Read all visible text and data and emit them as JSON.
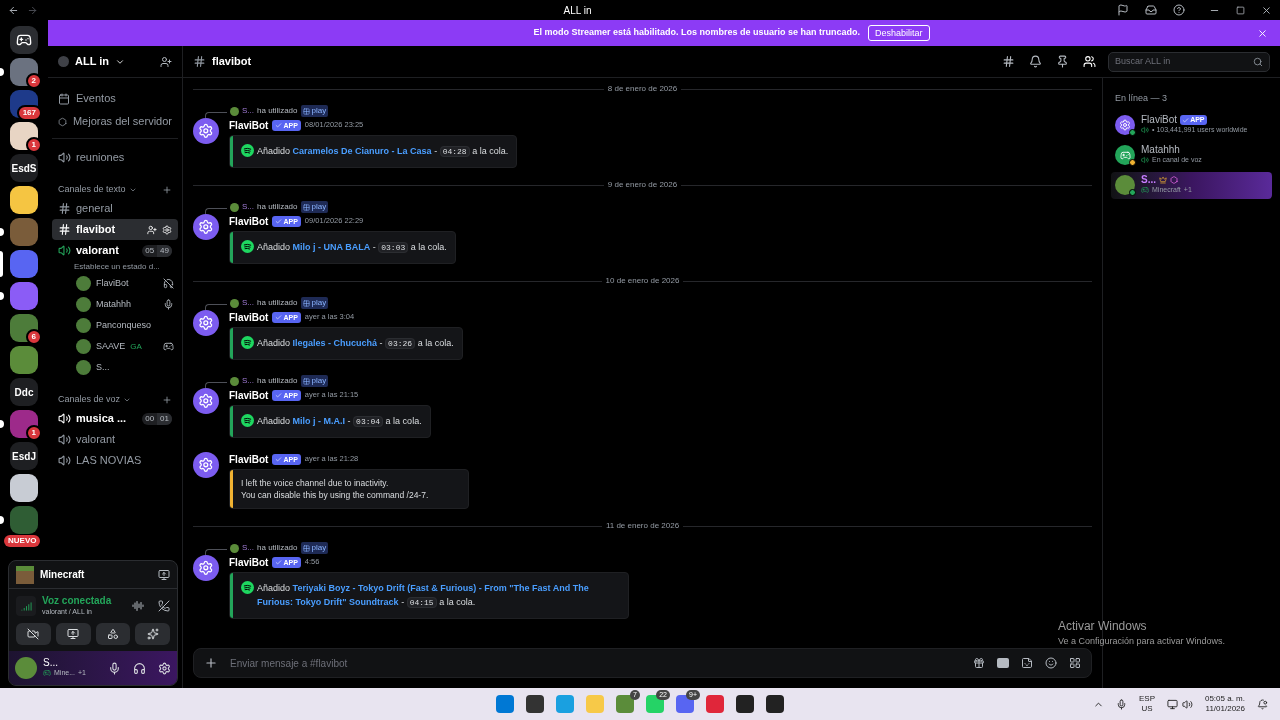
{
  "titlebar": {
    "title": "ALL in"
  },
  "servers": [
    {
      "kind": "home",
      "selected": false,
      "unread": false
    },
    {
      "kind": "photo",
      "badge": "2",
      "selected": false,
      "unread": true
    },
    {
      "kind": "photo",
      "badge": "167",
      "selected": false,
      "unread": false
    },
    {
      "kind": "photo",
      "badge": "1",
      "selected": false,
      "unread": false
    },
    {
      "kind": "text",
      "label": "EsdS",
      "selected": false,
      "unread": false
    },
    {
      "kind": "photo",
      "selected": false,
      "unread": false
    },
    {
      "kind": "photo",
      "selected": false,
      "unread": true
    },
    {
      "kind": "photo",
      "selected": true
    },
    {
      "kind": "photo",
      "selected": false,
      "unread": true
    },
    {
      "kind": "photo",
      "badge": "6",
      "selected": false,
      "unread": false
    },
    {
      "kind": "photo",
      "selected": false,
      "unread": false
    },
    {
      "kind": "text",
      "label": "Ddc",
      "selected": false,
      "unread": false
    },
    {
      "kind": "photo",
      "badge": "1",
      "selected": false,
      "unread": true
    },
    {
      "kind": "text",
      "label": "EsdJ",
      "selected": false,
      "unread": false
    },
    {
      "kind": "photo",
      "selected": false,
      "unread": false
    },
    {
      "kind": "photo",
      "badge": "NUEVO",
      "selected": false,
      "unread": true
    }
  ],
  "banner": {
    "text": "El modo Streamer está habilitado. Los nombres de usuario se han truncado.",
    "button": "Deshabilitar"
  },
  "channel_sidebar": {
    "server_name": "ALL in",
    "links": [
      {
        "kind": "events",
        "label": "Eventos"
      },
      {
        "kind": "boosts",
        "label": "Mejoras del servidor"
      }
    ],
    "standalone": [
      {
        "kind": "voice",
        "label": "reuniones",
        "selected": false
      }
    ],
    "categories": [
      {
        "label": "Canales de texto",
        "channels": [
          {
            "kind": "text",
            "label": "general",
            "selected": false
          },
          {
            "kind": "text",
            "label": "flavibot",
            "selected": true
          },
          {
            "kind": "voice",
            "label": "valorant",
            "selected": false,
            "counts": [
              "05",
              "49"
            ],
            "status": "Establece un estado d...",
            "members": [
              {
                "name": "FlaviBot",
                "kind": "deafened"
              },
              {
                "name": "Matahhh",
                "kind": "mic"
              },
              {
                "name": "Panconqueso"
              },
              {
                "name": "SAAVE",
                "activity": "GA",
                "kind": "console"
              },
              {
                "name": "S..."
              }
            ]
          }
        ]
      },
      {
        "label": "Canales de voz",
        "channels": [
          {
            "kind": "voice",
            "label": "musica ...",
            "selected": false,
            "counts": [
              "00",
              "01"
            ]
          },
          {
            "kind": "voice",
            "label": "valorant",
            "selected": false
          },
          {
            "kind": "voice",
            "label": "LAS NOVIAS",
            "selected": false
          }
        ]
      }
    ]
  },
  "user_panel": {
    "activity": "Minecraft",
    "voice_status": "Voz conectada",
    "voice_channel": "valorant / ALL in",
    "user_name": "S...",
    "user_activity": "Mine...",
    "user_extra": "+1"
  },
  "chat": {
    "channel": "flavibot",
    "search_placeholder": "Buscar ALL in",
    "composer_placeholder": "Enviar mensaje a #flavibot",
    "items": [
      {
        "kind": "divider",
        "date": "8 de enero de 2026"
      },
      {
        "kind": "message",
        "reply": {
          "user": "S...",
          "action": "ha utilizado",
          "command": "play"
        },
        "author": "FlaviBot",
        "badge": "APP",
        "time": "08/01/2026 23:25",
        "embed": {
          "kind": "queue",
          "color": "#23a55a",
          "prefix": "Añadido",
          "track": "Caramelos De Cianuro - La Casa",
          "separator": "-",
          "duration": "04:28",
          "suffix": "a la cola."
        }
      },
      {
        "kind": "divider",
        "date": "9 de enero de 2026"
      },
      {
        "kind": "message",
        "reply": {
          "user": "S...",
          "action": "ha utilizado",
          "command": "play"
        },
        "author": "FlaviBot",
        "badge": "APP",
        "time": "09/01/2026 22:29",
        "embed": {
          "kind": "queue",
          "color": "#23a55a",
          "prefix": "Añadido",
          "track": "Milo j - UNA BALA",
          "separator": "-",
          "duration": "03:03",
          "suffix": "a la cola."
        }
      },
      {
        "kind": "divider",
        "date": "10 de enero de 2026"
      },
      {
        "kind": "message",
        "reply": {
          "user": "S...",
          "action": "ha utilizado",
          "command": "play"
        },
        "author": "FlaviBot",
        "badge": "APP",
        "time": "ayer a las 3:04",
        "embed": {
          "kind": "queue",
          "color": "#23a55a",
          "prefix": "Añadido",
          "track": "Ilegales - Chucuchá",
          "separator": "-",
          "duration": "03:26",
          "suffix": "a la cola."
        }
      },
      {
        "kind": "message",
        "reply": {
          "user": "S...",
          "action": "ha utilizado",
          "command": "play"
        },
        "author": "FlaviBot",
        "badge": "APP",
        "time": "ayer a las 21:15",
        "embed": {
          "kind": "queue",
          "color": "#23a55a",
          "prefix": "Añadido",
          "track": "Milo j - M.A.I",
          "separator": "-",
          "duration": "03:04",
          "suffix": "a la cola."
        }
      },
      {
        "kind": "message",
        "author": "FlaviBot",
        "badge": "APP",
        "time": "ayer a las 21:28",
        "embed": {
          "kind": "notice",
          "color": "#f0b232",
          "lines": [
            "I left the voice channel due to inactivity.",
            "You can disable this by using the command /24-7."
          ]
        }
      },
      {
        "kind": "divider",
        "date": "11 de enero de 2026"
      },
      {
        "kind": "message",
        "reply": {
          "user": "S...",
          "action": "ha utilizado",
          "command": "play"
        },
        "author": "FlaviBot",
        "badge": "APP",
        "time": "4:56",
        "embed": {
          "kind": "queue",
          "color": "#23a55a",
          "prefix": "Añadido",
          "track": "Teriyaki Boyz - Tokyo Drift (Fast & Furious) - From \"The Fast And The Furious: Tokyo Drift\" Soundtrack",
          "separator": "-",
          "duration": "04:15",
          "suffix": "a la cola."
        }
      }
    ]
  },
  "members": {
    "heading": "En línea — 3",
    "list": [
      {
        "name": "FlaviBot",
        "badge": "APP",
        "status": "• 103,441,991 users worldwide",
        "color": "#23a55a",
        "kind": "bot"
      },
      {
        "name": "Matahhh",
        "status": "En canal de voz",
        "color": "#f0b232",
        "kind": "discord"
      },
      {
        "name": "S...",
        "status": "Minecraft",
        "extra": "+1",
        "color": "#23a55a",
        "kind": "boosted"
      }
    ]
  },
  "watermark": {
    "title": "Activar Windows",
    "subtitle": "Ve a Configuración para activar Windows."
  },
  "taskbar": {
    "apps": [
      {
        "kind": "windows"
      },
      {
        "kind": "taskview"
      },
      {
        "kind": "edge"
      },
      {
        "kind": "explorer"
      },
      {
        "kind": "minecraft",
        "badge": "7"
      },
      {
        "kind": "whatsapp",
        "badge": "22"
      },
      {
        "kind": "discord",
        "badge": "9+"
      },
      {
        "kind": "red"
      },
      {
        "kind": "steam"
      },
      {
        "kind": "epic"
      }
    ],
    "language": "ESP",
    "layout": "US",
    "time": "05:05 a. m.",
    "date": "11/01/2026"
  }
}
